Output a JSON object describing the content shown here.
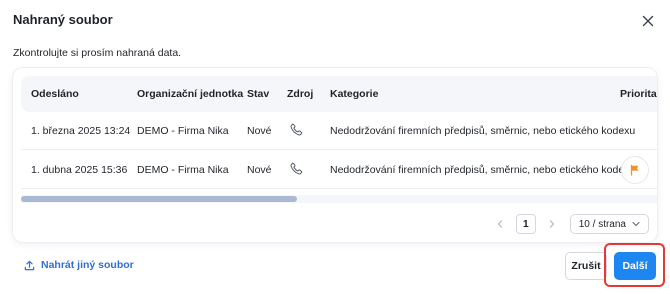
{
  "dialog": {
    "title": "Nahraný soubor",
    "subtitle": "Zkontrolujte si prosím nahraná data."
  },
  "table": {
    "columns": [
      "Odesláno",
      "Organizační jednotka",
      "Stav",
      "Zdroj",
      "Kategorie",
      "Priorita"
    ],
    "rows": [
      {
        "sent": "1. března 2025 13:24",
        "unit": "DEMO - Firma Nika",
        "status": "Nové",
        "source_icon": "phone-icon",
        "category": "Nedodržování firemních předpisů, směrnic, nebo etického kodexu",
        "priority": "-"
      },
      {
        "sent": "1. dubna 2025 15:36",
        "unit": "DEMO - Firma Nika",
        "status": "Nové",
        "source_icon": "phone-icon",
        "category": "Nedodržování firemních předpisů, směrnic, nebo etického kodexu",
        "priority_icon": "flag-icon",
        "priority_color": "#f0902e"
      }
    ]
  },
  "pagination": {
    "current_page": "1",
    "page_size": "10 / strana"
  },
  "footer": {
    "upload_other": "Nahrát jiný soubor",
    "cancel": "Zrušit",
    "next": "Další"
  },
  "colors": {
    "primary": "#1e86f0",
    "link": "#2f6fd3",
    "highlight": "#e53935",
    "flag": "#f0902e"
  }
}
